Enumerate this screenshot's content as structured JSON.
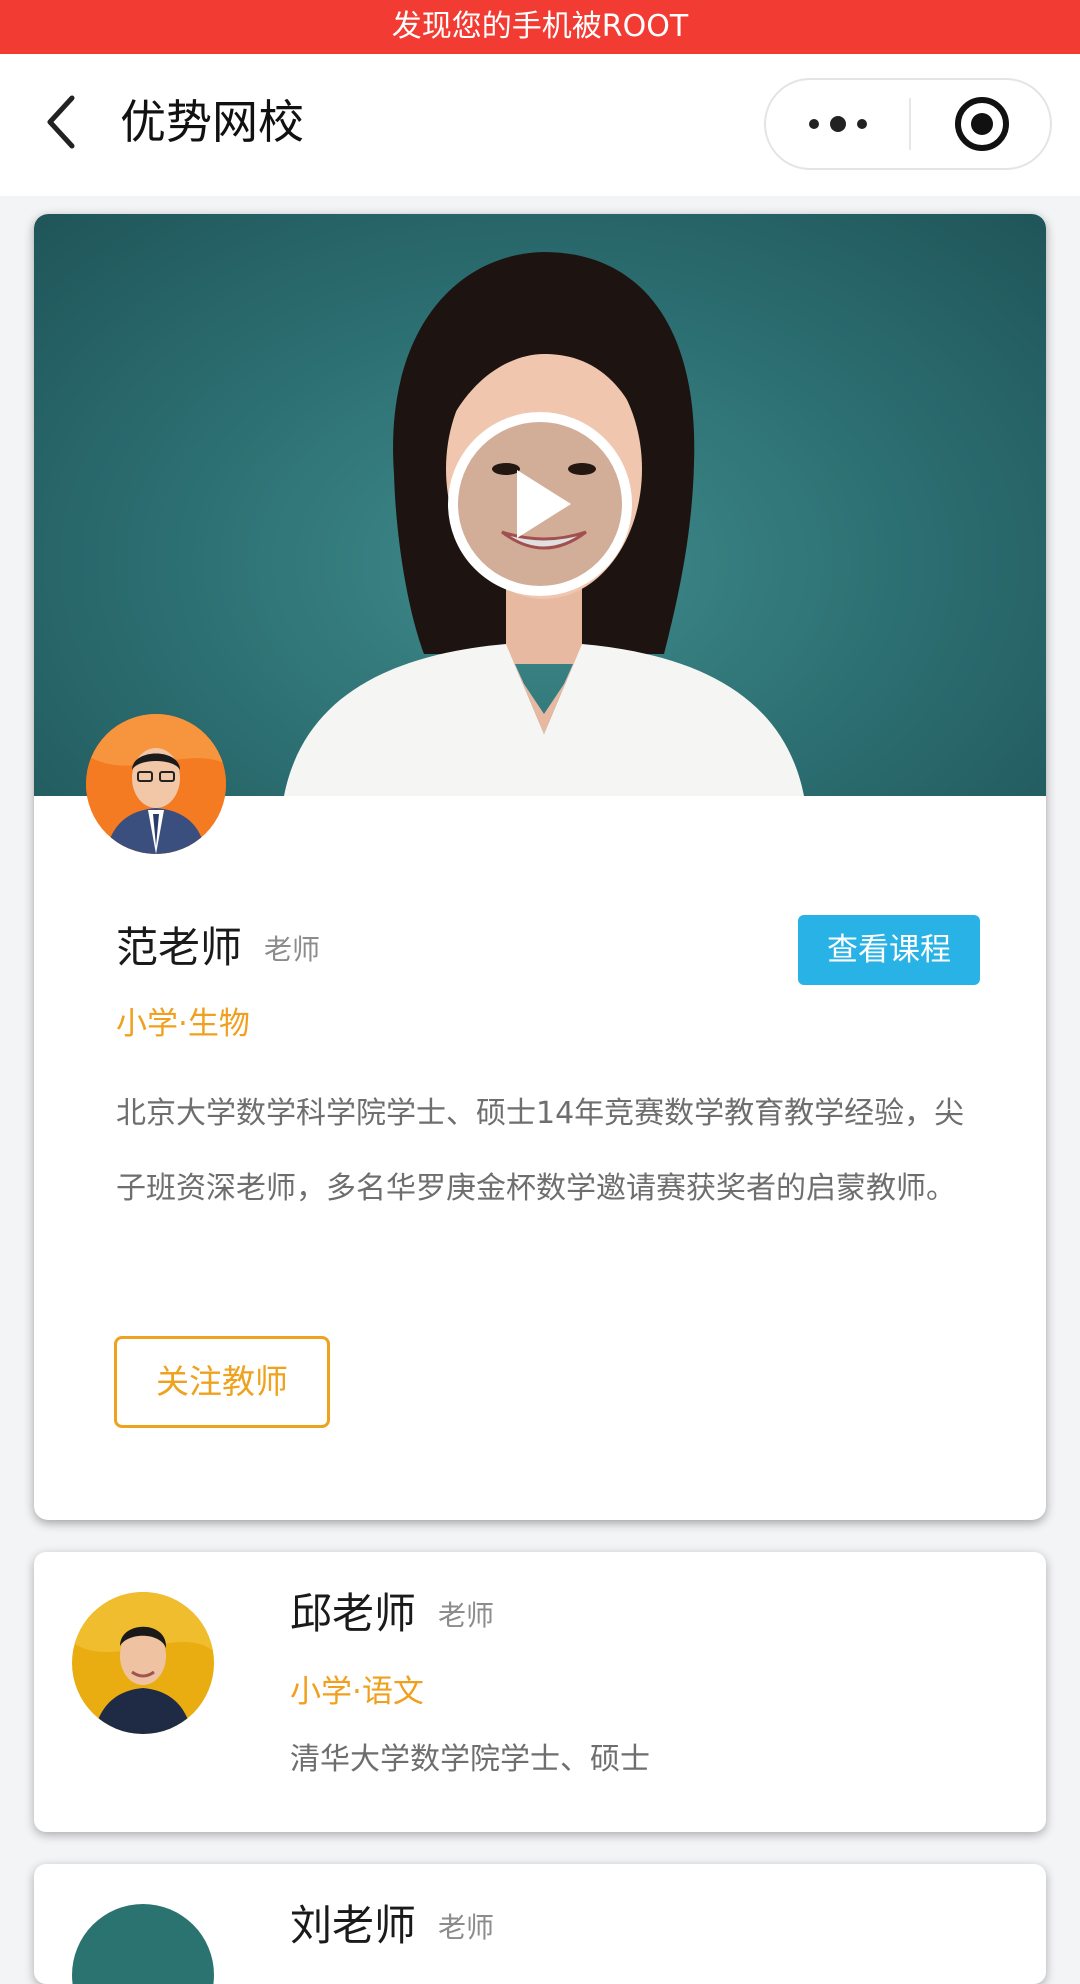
{
  "banner": {
    "text": "发现您的手机被ROOT"
  },
  "header": {
    "back_icon": "chevron-left-icon",
    "title": "优势网校",
    "more_icon": "more-dots-icon",
    "close_icon": "target-circle-icon"
  },
  "colors": {
    "banner_bg": "#f23b32",
    "accent_orange": "#f0a01e",
    "accent_blue": "#29b2e6",
    "video_bg": "#2b6d70"
  },
  "featured": {
    "play_icon": "play-icon",
    "name": "范老师",
    "role": "老师",
    "view_course_label": "查看课程",
    "subject": "小学·生物",
    "bio": "北京大学数学科学院学士、硕士14年竞赛数学教育教学经验，尖子班资深老师，多名华罗庚金杯数学邀请赛获奖者的启蒙教师。",
    "follow_label": "关注教师"
  },
  "teachers": [
    {
      "name": "邱老师",
      "role": "老师",
      "subject": "小学·语文",
      "bio": "清华大学数学院学士、硕士"
    },
    {
      "name": "刘老师",
      "role": "老师"
    }
  ]
}
